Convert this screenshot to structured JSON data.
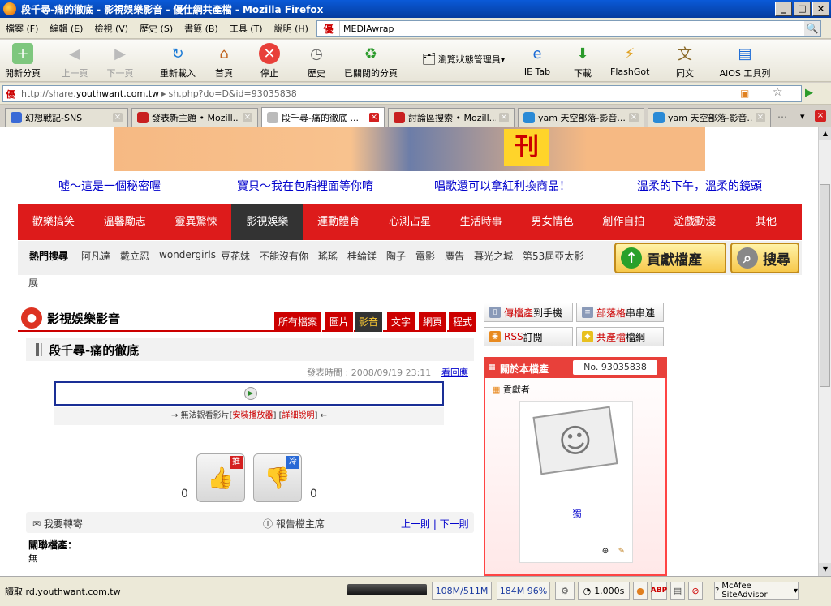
{
  "window": {
    "title": "段千尋-痛的徹底 - 影視娛樂影音 - 優仕網共產檔 - Mozilla Firefox"
  },
  "menu": [
    "檔案 (F)",
    "編輯 (E)",
    "檢視 (V)",
    "歷史 (S)",
    "書籤 (B)",
    "工具 (T)",
    "說明 (H)"
  ],
  "search": {
    "engine_label": "優",
    "value": "MEDIAwrap"
  },
  "toolbar": [
    {
      "label": "開新分頁",
      "icon": "new-tab-icon"
    },
    {
      "label": "上一頁",
      "icon": "back-icon"
    },
    {
      "label": "下一頁",
      "icon": "forward-icon"
    },
    {
      "label": "重新載入",
      "icon": "reload-icon"
    },
    {
      "label": "首頁",
      "icon": "home-icon"
    },
    {
      "label": "停止",
      "icon": "stop-icon"
    },
    {
      "label": "歷史",
      "icon": "history-icon"
    },
    {
      "label": "已關閉的分頁",
      "icon": "closed-tabs-icon"
    },
    {
      "label": "瀏覽狀態管理員",
      "icon": "session-manager-icon"
    },
    {
      "label": "IE Tab",
      "icon": "ie-tab-icon"
    },
    {
      "label": "下載",
      "icon": "download-icon"
    },
    {
      "label": "FlashGot",
      "icon": "flashgot-icon"
    },
    {
      "label": "同文",
      "icon": "tongwen-icon"
    },
    {
      "label": "AiOS 工具列",
      "icon": "aios-icon"
    }
  ],
  "address": {
    "prefix": "http://share.",
    "host": "youthwant.com.tw",
    "path": " sh.php?do=D&id=93035838"
  },
  "tabs": [
    {
      "label": "幻想戰記-SNS"
    },
    {
      "label": "發表新主題 • Mozill..."
    },
    {
      "label": "段千尋-痛的徹底 ..."
    },
    {
      "label": "討論區搜索 • Mozill..."
    },
    {
      "label": "yam 天空部落-影音..."
    },
    {
      "label": "yam 天空部落-影音..."
    }
  ],
  "banner": {
    "text": "刊"
  },
  "promos": [
    "噓～這是一個秘密喔",
    "寶貝～我在包廂裡面等你唷",
    "唱歌還可以拿紅利換商品！",
    "溫柔的下午，溫柔的鏡頭"
  ],
  "categories": [
    "歡樂搞笑",
    "溫馨勵志",
    "靈異驚悚",
    "影視娛樂",
    "運動體育",
    "心測占星",
    "生活時事",
    "男女情色",
    "創作自拍",
    "遊戲動漫",
    "其他"
  ],
  "hot": {
    "title": "熱門搜尋",
    "keywords": [
      "阿凡達",
      "戴立忍",
      "wondergirls",
      "豆花妹",
      "不能沒有你",
      "瑤瑤",
      "桂綸鎂",
      "陶子",
      "電影",
      "廣告",
      "暮光之城",
      "第53屆亞太影"
    ],
    "cont": "展"
  },
  "buttons": {
    "contribute": "貢獻檔產",
    "search": "搜尋"
  },
  "section": {
    "title": "影視娛樂影音",
    "subtabs": [
      "所有檔案",
      "圖片",
      "影音",
      "文字",
      "網頁",
      "程式"
    ]
  },
  "post": {
    "title": "段千尋-痛的徹底",
    "pub_time": "發表時間 : 2008/09/19 23:11",
    "back_label": "看回應",
    "player_msg_pre": "→ 無法觀看影片[",
    "player_link1": "安裝播放器",
    "player_mid": "] [",
    "player_link2": "詳細說明",
    "player_msg_post": "] ←"
  },
  "votes": {
    "up_tag": "推",
    "down_tag": "冷",
    "up_count": "0",
    "down_count": "0"
  },
  "actions": {
    "forward": "我要轉寄",
    "report": "報告檔主席",
    "nav": "上一則 | 下一則"
  },
  "related": {
    "label": "關聯檔產：",
    "value": "無"
  },
  "side": {
    "b1": [
      "傳檔產",
      "到手機"
    ],
    "b2": [
      "部落格",
      "串串連"
    ],
    "b3": [
      "RSS",
      "訂閱"
    ],
    "b4": [
      "共產檔",
      "檔綱"
    ]
  },
  "about": {
    "title": "關於本檔產",
    "no": "No. 93035838",
    "contributor_label": "貢獻者",
    "user": "獨"
  },
  "status": {
    "text": "讀取 rd.youthwant.com.tw",
    "mem1": "108M/511M",
    "mem2": "184M 96%",
    "time": "1.000s",
    "mcafee": "McAfee SiteAdvisor"
  }
}
